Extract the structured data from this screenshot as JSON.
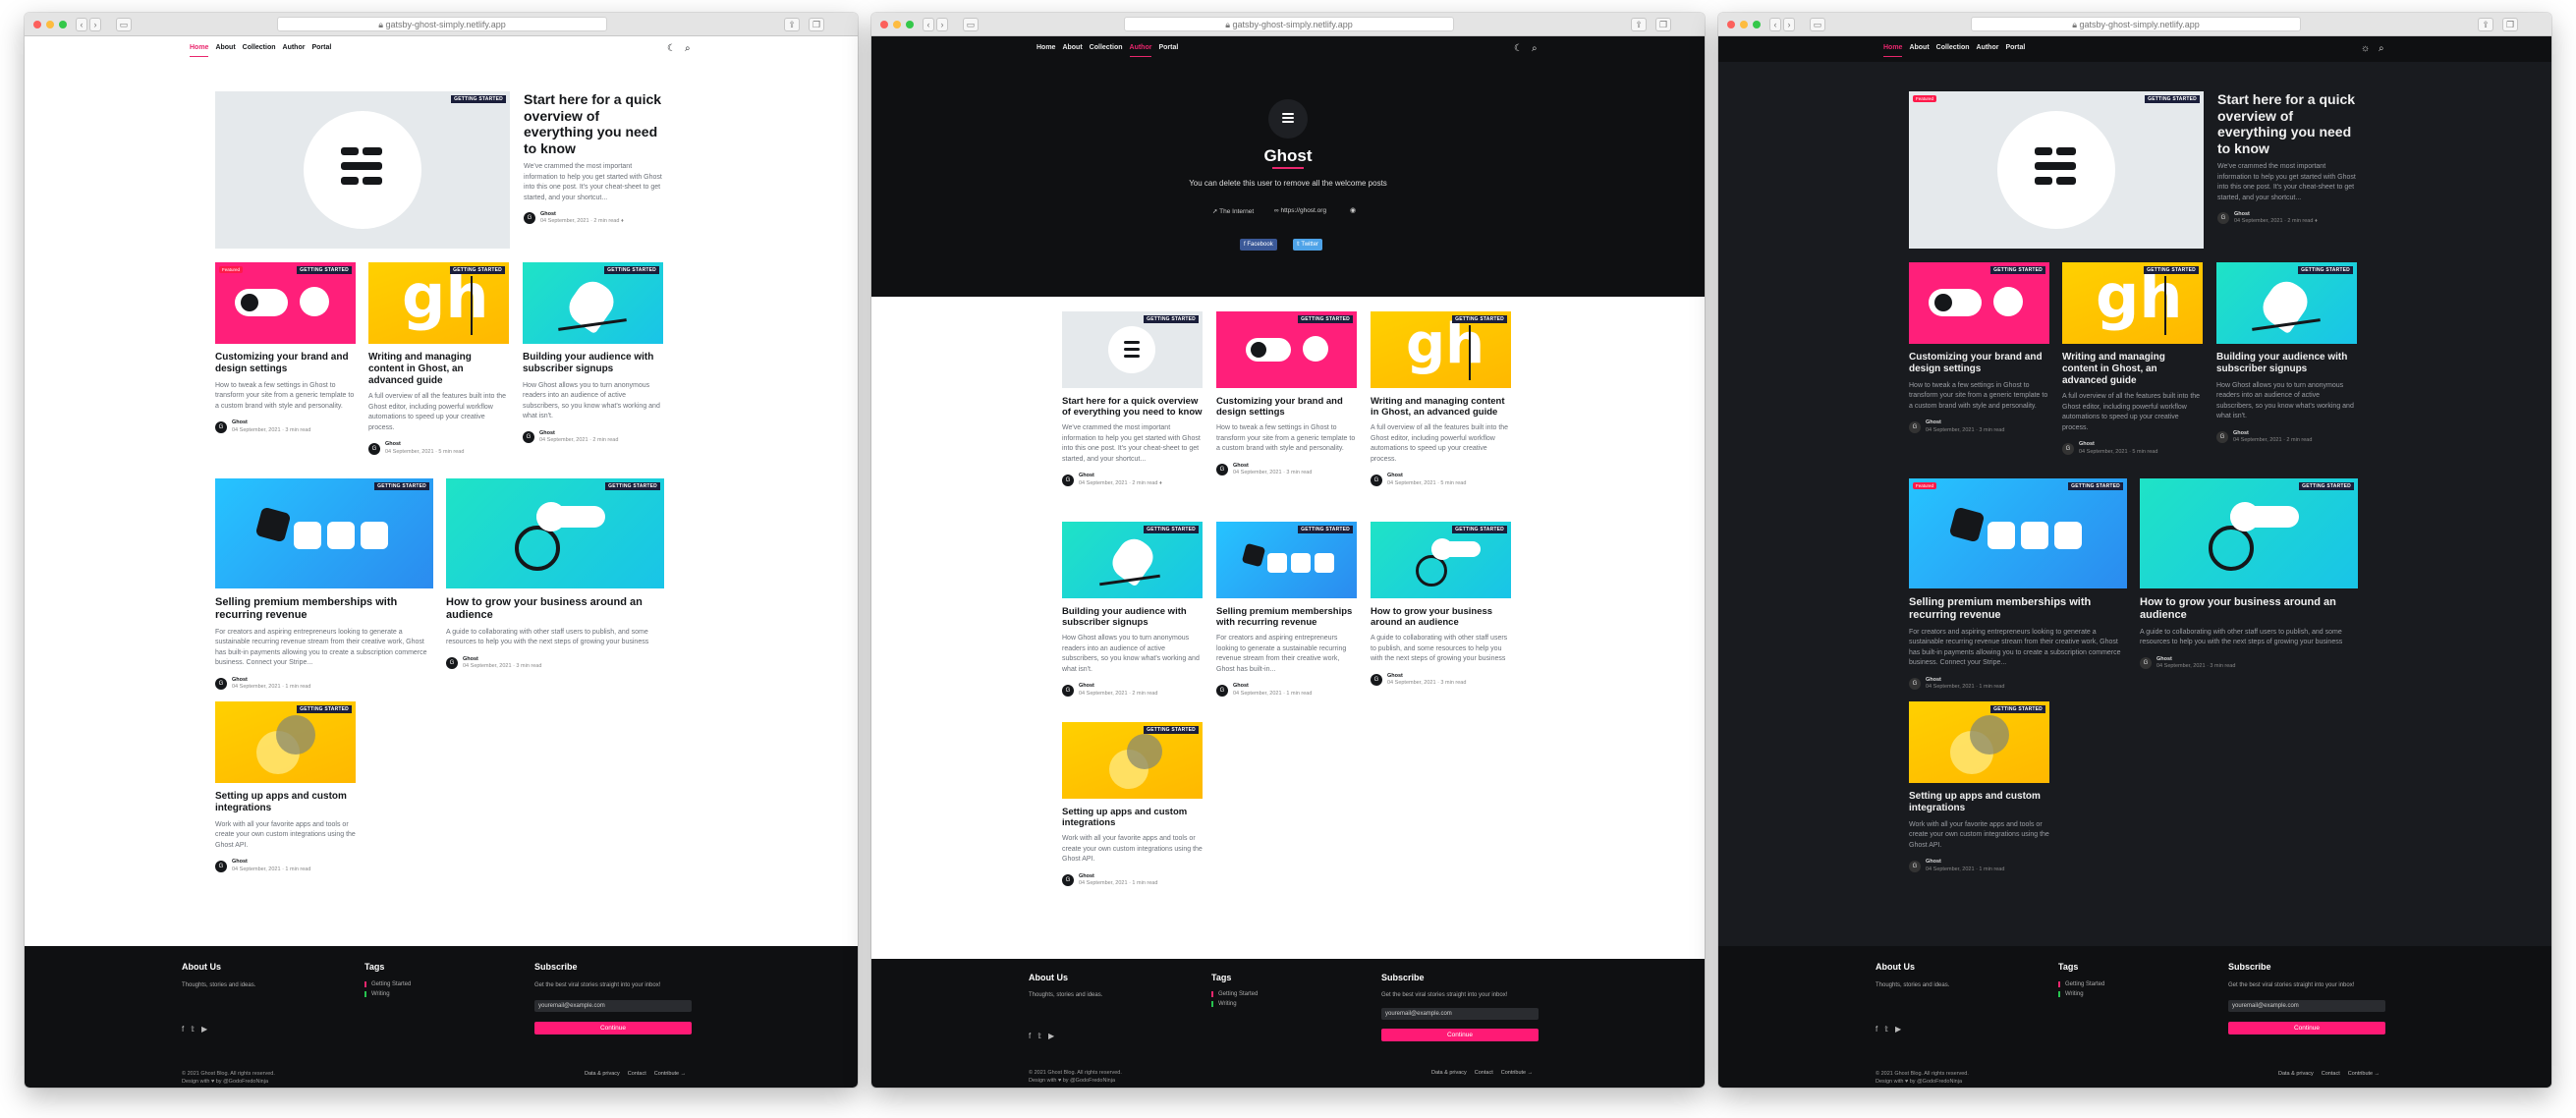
{
  "browser": {
    "url": "gatsby-ghost-simply.netlify.app"
  },
  "nav": {
    "home": "Home",
    "about": "About",
    "collection": "Collection",
    "author": "Author",
    "portal": "Portal",
    "icons": {
      "theme": "moon-icon",
      "search": "search-icon",
      "sun": "sun-icon"
    }
  },
  "posts": {
    "p1": {
      "title": "Start here for a quick overview of everything you need to know",
      "excerpt": "We've crammed the most important information to help you get started with Ghost into this one post. It's your cheat-sheet to get started, and your shortcut...",
      "date": "04 September, 2021 · 2 min read ♦"
    },
    "p2": {
      "title": "Customizing your brand and design settings",
      "excerpt": "How to tweak a few settings in Ghost to transform your site from a generic template to a custom brand with style and personality.",
      "date": "04 September, 2021 · 3 min read"
    },
    "p3": {
      "title": "Writing and managing content in Ghost, an advanced guide",
      "excerpt": "A full overview of all the features built into the Ghost editor, including powerful workflow automations to speed up your creative process.",
      "date": "04 September, 2021 · 5 min read"
    },
    "p4": {
      "title": "Building your audience with subscriber signups",
      "excerpt": "How Ghost allows you to turn anonymous readers into an audience of active subscribers, so you know what's working and what isn't.",
      "date": "04 September, 2021 · 2 min read"
    },
    "p5": {
      "title": "Selling premium memberships with recurring revenue",
      "excerpt": "For creators and aspiring entrepreneurs looking to generate a sustainable recurring revenue stream from their creative work, Ghost has built-in payments allowing you to create a subscription commerce business. Connect your Stripe...",
      "date": "04 September, 2021 · 1 min read"
    },
    "p6": {
      "title": "How to grow your business around an audience",
      "excerpt": "A guide to collaborating with other staff users to publish, and some resources to help you with the next steps of growing your business",
      "date": "04 September, 2021 · 3 min read"
    },
    "p7": {
      "title": "Setting up apps and custom integrations",
      "excerpt": "Work with all your favorite apps and tools or create your own custom integrations using the Ghost API.",
      "date": "04 September, 2021 · 1 min read"
    },
    "p5b": {
      "excerpt": "For creators and aspiring entrepreneurs looking to generate a sustainable recurring revenue stream from their creative work, Ghost has built-in..."
    },
    "p5b_date": "04 September, 2021 · 1 min read",
    "p4b_date": "04 September, 2021 · 2 min read",
    "p6b_date": "04 September, 2021 · 3 min read"
  },
  "card": {
    "tag": "GETTING STARTED",
    "author": "Ghost",
    "avatar": "G",
    "featured": "Featured"
  },
  "author_page": {
    "name": "Ghost",
    "bio": "You can delete this user to remove all the welcome posts",
    "location": "The Internet",
    "website": "https://ghost.org",
    "facebook": "Facebook",
    "twitter": "Twitter"
  },
  "footer": {
    "about_title": "About Us",
    "about_text": "Thoughts, stories and ideas.",
    "tags_title": "Tags",
    "tag1": "Getting Started",
    "tag2": "Writing",
    "subscribe_title": "Subscribe",
    "subscribe_text": "Get the best viral stories straight into your inbox!",
    "email_placeholder": "youremail@example.com",
    "continue": "Continue",
    "copyright": "© 2021 Ghost Blog. All rights reserved.",
    "credit": "Design with ♥ by @GodoFredoNinja",
    "links": {
      "privacy": "Data & privacy",
      "contact": "Contact",
      "contribute": "Contribute →"
    }
  },
  "colors": {
    "accent": "#e9266d",
    "dark_bg": "#191b1f",
    "tag_bg": "#1a1e3a"
  }
}
